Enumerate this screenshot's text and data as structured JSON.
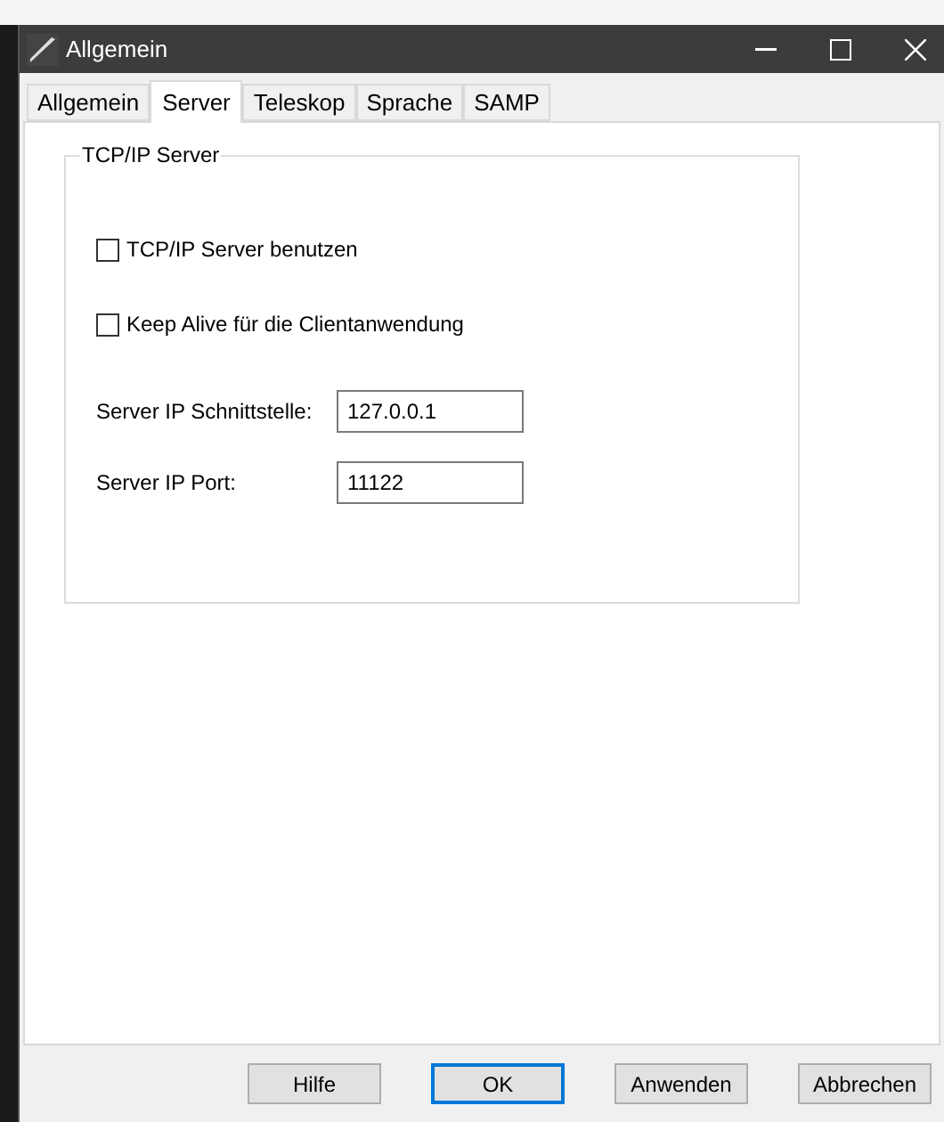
{
  "window": {
    "title": "Allgemein"
  },
  "tabs": [
    {
      "label": "Allgemein",
      "selected": false
    },
    {
      "label": "Server",
      "selected": true
    },
    {
      "label": "Teleskop",
      "selected": false
    },
    {
      "label": "Sprache",
      "selected": false
    },
    {
      "label": "SAMP",
      "selected": false
    }
  ],
  "group": {
    "title": "TCP/IP Server",
    "checkboxes": [
      {
        "label": "TCP/IP Server benutzen",
        "checked": false
      },
      {
        "label": "Keep Alive für die Clientanwendung",
        "checked": false
      }
    ],
    "fields": [
      {
        "label": "Server IP Schnittstelle:",
        "value": "127.0.0.1"
      },
      {
        "label": "Server IP Port:",
        "value": "11122"
      }
    ]
  },
  "buttons": [
    {
      "label": "Hilfe",
      "default": false
    },
    {
      "label": "OK",
      "default": true
    },
    {
      "label": "Anwenden",
      "default": false
    },
    {
      "label": "Abbrechen",
      "default": false
    }
  ]
}
